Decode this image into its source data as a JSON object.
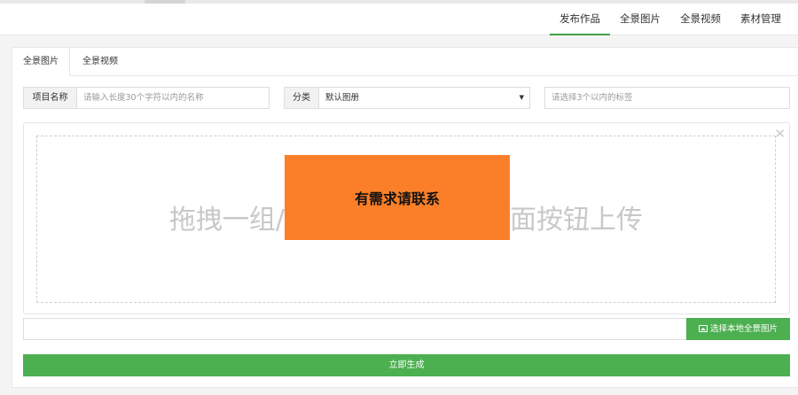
{
  "topnav": {
    "items": [
      {
        "label": "发布作品",
        "active": true
      },
      {
        "label": "全景图片",
        "active": false
      },
      {
        "label": "全景视频",
        "active": false
      },
      {
        "label": "素材管理",
        "active": false
      }
    ]
  },
  "tabs": [
    {
      "label": "全景图片",
      "active": true
    },
    {
      "label": "全景视频",
      "active": false
    }
  ],
  "form": {
    "project_name_label": "项目名称",
    "project_name_placeholder": "请输入长度30个字符以内的名称",
    "category_label": "分类",
    "category_value": "默认图册",
    "tags_placeholder": "请选择3个以内的标签"
  },
  "upload": {
    "drop_text_left": "拖拽一组/",
    "drop_text_right": "面按钮上传",
    "overlay_text": "有需求请联系",
    "close_icon": "close-icon",
    "select_button": "选择本地全景图片",
    "select_icon": "image-icon"
  },
  "generate_button": "立即生成",
  "colors": {
    "accent": "#4caf50",
    "overlay": "#fb7f29"
  }
}
